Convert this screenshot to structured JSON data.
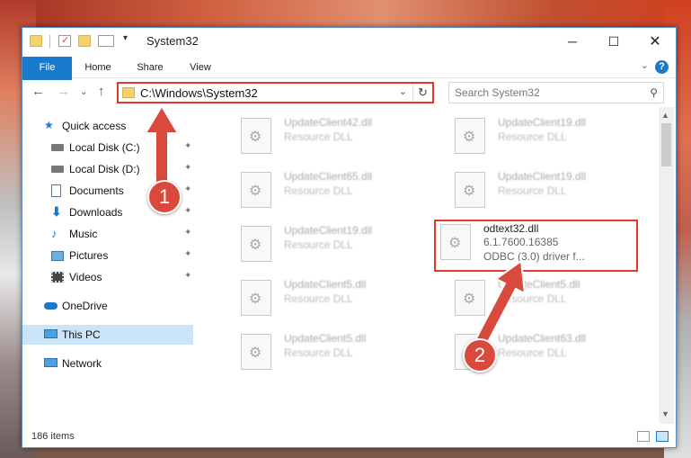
{
  "title": "System32",
  "ribbon_tabs": [
    "File",
    "Home",
    "Share",
    "View"
  ],
  "address": "C:\\Windows\\System32",
  "search_placeholder": "Search System32",
  "sidebar": [
    {
      "label": "Quick access",
      "icon": "star-icon"
    },
    {
      "label": "Local Disk (C:)",
      "icon": "drive-icon",
      "pinned": true
    },
    {
      "label": "Local Disk (D:)",
      "icon": "drive-icon",
      "pinned": true
    },
    {
      "label": "Documents",
      "icon": "documents-icon",
      "pinned": true
    },
    {
      "label": "Downloads",
      "icon": "download-icon",
      "pinned": true
    },
    {
      "label": "Music",
      "icon": "music-icon",
      "pinned": true
    },
    {
      "label": "Pictures",
      "icon": "pictures-icon",
      "pinned": true
    },
    {
      "label": "Videos",
      "icon": "videos-icon",
      "pinned": true
    },
    {
      "label": "OneDrive",
      "icon": "cloud-icon"
    },
    {
      "label": "This PC",
      "icon": "pc-icon",
      "selected": true
    },
    {
      "label": "Network",
      "icon": "network-icon"
    }
  ],
  "files": [
    {
      "name": "UpdateClient42.dll",
      "desc": "Resource DLL"
    },
    {
      "name": "UpdateClient19.dll",
      "desc": "Resource DLL"
    },
    {
      "name": "UpdateClient65.dll",
      "desc": "Resource DLL"
    },
    {
      "name": "UpdateClient19.dll",
      "desc": "Resource DLL"
    },
    {
      "name": "UpdateClient19.dll",
      "desc": "Resource DLL"
    },
    {
      "name": "odtext32.dll",
      "version": "6.1.7600.16385",
      "desc": "ODBC (3.0) driver f..."
    },
    {
      "name": "UpdateClient5.dll",
      "desc": "Resource DLL"
    },
    {
      "name": "UpdateClient5.dll",
      "desc": "Resource DLL"
    },
    {
      "name": "UpdateClient5.dll",
      "desc": "Resource DLL"
    },
    {
      "name": "UpdateClient63.dll",
      "desc": "Resource DLL"
    }
  ],
  "status": "186 items",
  "badges": [
    "1",
    "2"
  ],
  "colors": {
    "accent": "#1979ca",
    "highlight": "#e0392b",
    "folder": "#f3d16c"
  }
}
